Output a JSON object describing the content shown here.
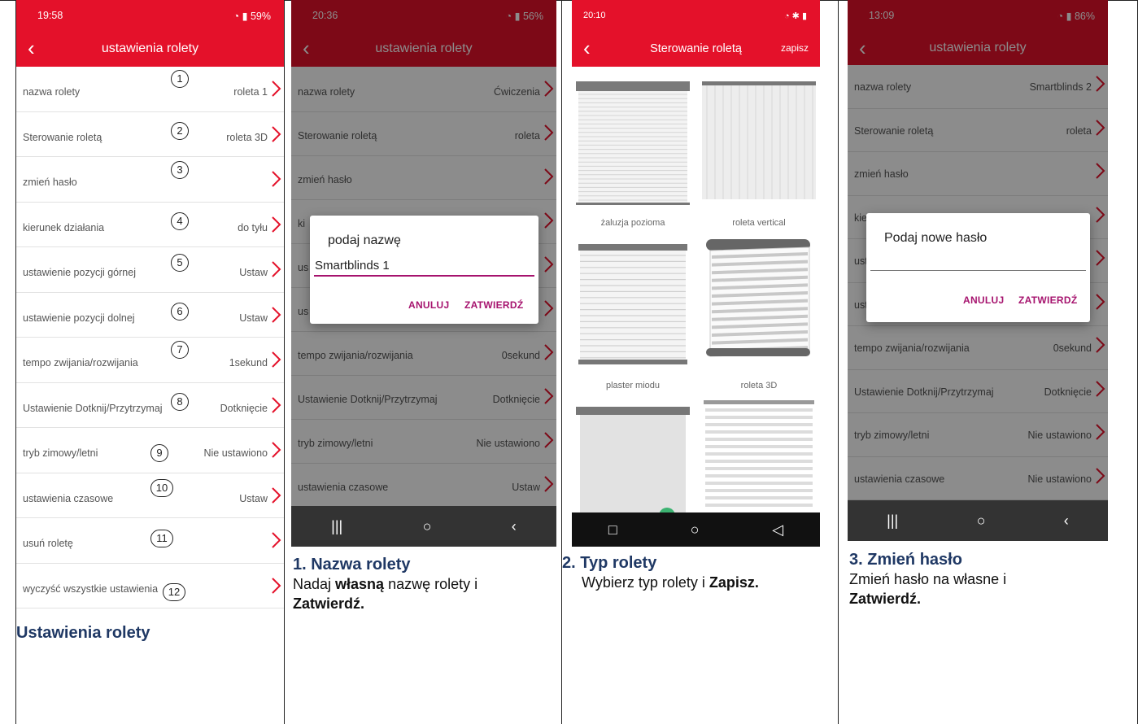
{
  "colors": {
    "accent": "#e4112a",
    "dialog_button": "#a6136e",
    "caption_title": "#1f3864"
  },
  "panel1": {
    "status": {
      "time": "19:58",
      "battery": "59%"
    },
    "title": "ustawienia rolety",
    "back_icon": "chevron-left-icon",
    "rows": [
      {
        "label": "nazwa rolety",
        "value": "roleta 1",
        "num": "1"
      },
      {
        "label": "Sterowanie roletą",
        "value": "roleta 3D",
        "num": "2"
      },
      {
        "label": "zmień hasło",
        "value": "",
        "num": "3"
      },
      {
        "label": "kierunek działania",
        "value": "do tyłu",
        "num": "4"
      },
      {
        "label": "ustawienie pozycji górnej",
        "value": "Ustaw",
        "num": "5"
      },
      {
        "label": "ustawienie pozycji dolnej",
        "value": "Ustaw",
        "num": "6"
      },
      {
        "label": "tempo zwijania/rozwijania",
        "value": "1sekund",
        "num": "7"
      },
      {
        "label": "Ustawienie Dotknij/Przytrzymaj",
        "value": "Dotknięcie",
        "num": "8"
      },
      {
        "label": "tryb zimowy/letni",
        "value": "Nie ustawiono",
        "num": "9"
      },
      {
        "label": "ustawienia czasowe",
        "value": "Ustaw",
        "num": "10"
      },
      {
        "label": "usuń roletę",
        "value": "",
        "num": "11"
      },
      {
        "label": "wyczyść wszystkie ustawienia",
        "value": "",
        "num": "12"
      }
    ],
    "caption_title": "Ustawienia rolety"
  },
  "panel2": {
    "status": {
      "time": "20:36",
      "battery": "56%"
    },
    "title": "ustawienia rolety",
    "rows": [
      {
        "label": "nazwa rolety",
        "value": "Ćwiczenia"
      },
      {
        "label": "Sterowanie roletą",
        "value": "roleta"
      },
      {
        "label": "zmień hasło",
        "value": ""
      },
      {
        "label": "ki",
        "value": ""
      },
      {
        "label": "us",
        "value": ""
      },
      {
        "label": "us",
        "value": ""
      },
      {
        "label": "tempo zwijania/rozwijania",
        "value": "0sekund"
      },
      {
        "label": "Ustawienie Dotknij/Przytrzymaj",
        "value": "Dotknięcie"
      },
      {
        "label": "tryb zimowy/letni",
        "value": "Nie ustawiono"
      },
      {
        "label": "ustawienia czasowe",
        "value": "Ustaw"
      }
    ],
    "dialog": {
      "title": "podaj nazwę",
      "input_value": "Smartblinds 1",
      "cancel": "ANULUJ",
      "confirm": "ZATWIERDŹ"
    },
    "nav": [
      "|||",
      "○",
      "‹"
    ],
    "caption": {
      "title": "1. Nazwa rolety",
      "line1_a": "Nadaj ",
      "line1_b": "własną",
      "line1_c": " nazwę rolety i",
      "line2": "Zatwierdź."
    }
  },
  "panel3": {
    "status": {
      "time": "20:10",
      "battery": ""
    },
    "title": "Sterowanie roletą",
    "save": "zapisz",
    "tiles": [
      "żaluzja pozioma",
      "roleta vertical",
      "plaster miodu",
      "roleta 3D"
    ],
    "nav": [
      "□",
      "○",
      "◁"
    ],
    "caption": {
      "title": "2. Typ rolety",
      "line1_a": "Wybierz typ rolety i ",
      "line1_b": "Zapisz."
    }
  },
  "panel4": {
    "status": {
      "time": "13:09",
      "battery": "86%"
    },
    "title": "ustawienia rolety",
    "rows": [
      {
        "label": "nazwa rolety",
        "value": "Smartblinds 2"
      },
      {
        "label": "Sterowanie roletą",
        "value": "roleta"
      },
      {
        "label": "zmień hasło",
        "value": ""
      },
      {
        "label": "kie",
        "value": ""
      },
      {
        "label": "ust",
        "value": ""
      },
      {
        "label": "ust",
        "value": ""
      },
      {
        "label": "tempo zwijania/rozwijania",
        "value": "0sekund"
      },
      {
        "label": "Ustawienie Dotknij/Przytrzymaj",
        "value": "Dotknięcie"
      },
      {
        "label": "tryb zimowy/letni",
        "value": "Nie ustawiono"
      },
      {
        "label": "ustawienia czasowe",
        "value": "Nie ustawiono"
      }
    ],
    "dialog": {
      "title": "Podaj nowe hasło",
      "cancel": "ANULUJ",
      "confirm": "ZATWIERDŹ"
    },
    "nav": [
      "|||",
      "○",
      "‹"
    ],
    "caption": {
      "title": "3. Zmień hasło",
      "line1": "Zmień hasło na własne i",
      "line2": "Zatwierdź."
    }
  }
}
